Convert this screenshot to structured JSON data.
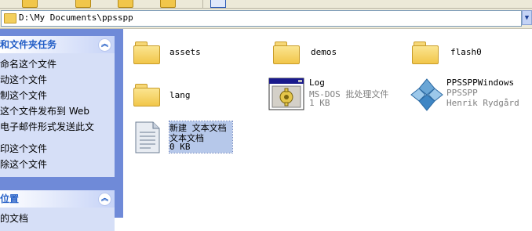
{
  "toolbar": {
    "icons": [
      "folder-icon",
      "folder-icon",
      "folder-icon",
      "folder-icon",
      "window-icon"
    ]
  },
  "address": {
    "path": "D:\\My Documents\\ppsspp"
  },
  "task_pane": {
    "file_tasks": {
      "title": "和文件夹任务",
      "items": [
        "命名这个文件",
        "动这个文件",
        "制这个文件",
        "这个文件发布到 Web",
        "电子邮件形式发送此文",
        "印这个文件",
        "除这个文件"
      ]
    },
    "other_places": {
      "title": "位置",
      "items": [
        "的文档"
      ]
    }
  },
  "files": [
    {
      "name": "assets",
      "icon": "folder-icon"
    },
    {
      "name": "demos",
      "icon": "folder-icon"
    },
    {
      "name": "flash0",
      "icon": "folder-icon"
    },
    {
      "name": "lang",
      "icon": "folder-icon"
    },
    {
      "name": "Log",
      "icon": "batch-file-icon",
      "type": "MS-DOS 批处理文件",
      "size": "1 KB"
    },
    {
      "name": "PPSSPPWindows",
      "icon": "ppsspp-icon",
      "type": "PPSSPP",
      "author": "Henrik Rydgård"
    },
    {
      "name": "新建 文本文档",
      "icon": "text-document-icon",
      "type": "文本文档",
      "size": "0 KB",
      "selected": true
    }
  ],
  "colors": {
    "taskpane": "#6f8ad8",
    "panel_body": "#d6dff7",
    "panel_title": "#215dc6",
    "selection": "#b6c8ea"
  }
}
